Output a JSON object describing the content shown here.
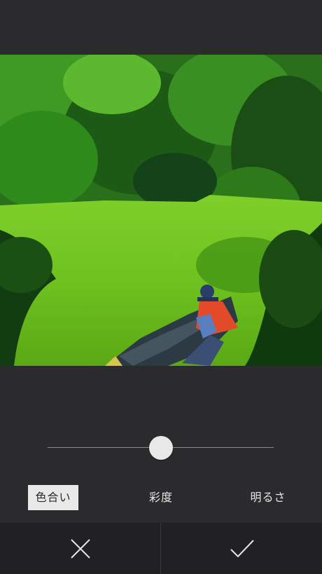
{
  "editor": {
    "photo": {
      "description_icon": "photo-preview"
    },
    "slider": {
      "value_fraction": 0.5
    },
    "tabs": [
      {
        "label": "色合い",
        "active": true
      },
      {
        "label": "彩度",
        "active": false
      },
      {
        "label": "明るさ",
        "active": false
      }
    ],
    "actions": {
      "cancel_icon": "close-icon",
      "confirm_icon": "check-icon"
    }
  },
  "colors": {
    "background": "#2b2b2d",
    "bottom_bar": "#212123",
    "active_tab_bg": "#e9e9e9",
    "text": "#e6e6e6"
  }
}
